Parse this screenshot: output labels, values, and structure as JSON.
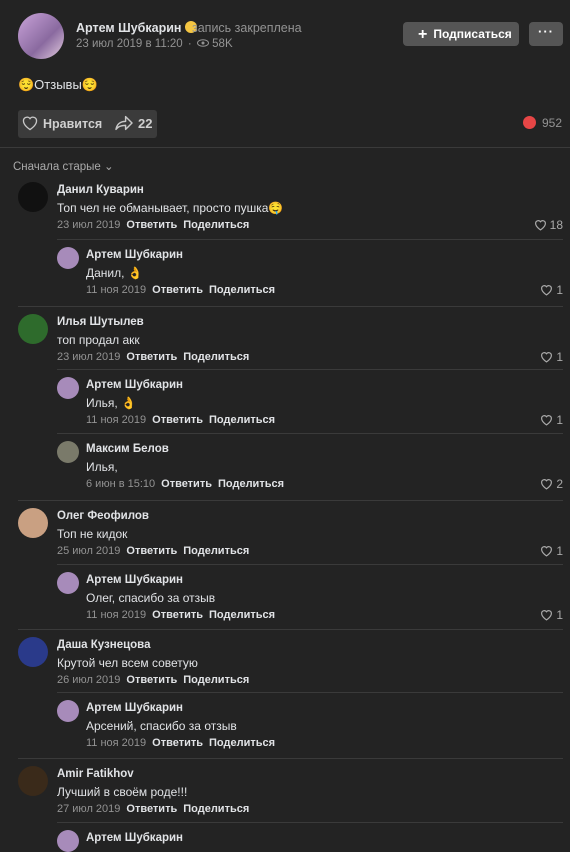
{
  "post": {
    "author": "Артем Шубкарин",
    "pinned": "запись закреплена",
    "date": "23 июл 2019 в 11:20",
    "views": "58K",
    "subscribe": "Подписаться",
    "more": "···",
    "text": "😌Отзывы😌",
    "like_label": "Нравится",
    "shares": "22",
    "likes": "952",
    "sort": "Сначала старые"
  },
  "actions": {
    "reply": "Ответить",
    "share": "Поделиться"
  },
  "comments": [
    {
      "name": "Данил Куварин",
      "text": "Топ чел не обманывает, просто пушка🤤",
      "date": "23 июл 2019",
      "likes": "18"
    },
    {
      "name": "Артем Шубкарин",
      "text": "Данил, 👌",
      "date": "11 ноя 2019",
      "likes": "1"
    },
    {
      "name": "Илья Шутылев",
      "text": "топ продал акк",
      "date": "23 июл 2019",
      "likes": "1"
    },
    {
      "name": "Артем Шубкарин",
      "text": "Илья, 👌",
      "date": "11 ноя 2019",
      "likes": "1"
    },
    {
      "name": "Максим Белов",
      "text": "Илья,",
      "date": "6 июн в 15:10",
      "likes": "2"
    },
    {
      "name": "Олег Феофилов",
      "text": "Топ не кидок",
      "date": "25 июл 2019",
      "likes": "1"
    },
    {
      "name": "Артем Шубкарин",
      "text": "Олег, спасибо за отзыв",
      "date": "11 ноя 2019",
      "likes": "1"
    },
    {
      "name": "Даша Кузнецова",
      "text": "Крутой чел всем советую",
      "date": "26 июл 2019",
      "likes": ""
    },
    {
      "name": "Артем Шубкарин",
      "text": "Арсений, спасибо за отзыв",
      "date": "11 ноя 2019",
      "likes": ""
    },
    {
      "name": "Amir Fatikhov",
      "text": "Лучший в своём роде!!!",
      "date": "27 июл 2019",
      "likes": ""
    },
    {
      "name": "Артем Шубкарин",
      "text": "",
      "date": "",
      "likes": ""
    }
  ]
}
